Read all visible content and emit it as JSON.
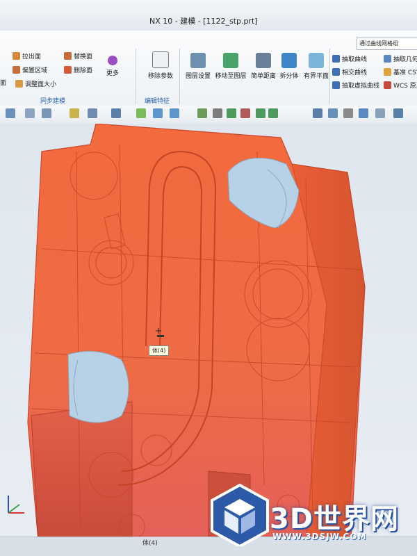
{
  "window": {
    "title": "NX 10 - 建模 - [1122_stp.prt]"
  },
  "search": {
    "value": "通过曲线网格组"
  },
  "ribbon": {
    "sync_group": {
      "label": "同步建模",
      "items": [
        "拉出面",
        "偏置区域",
        "调整面大小",
        "替换面",
        "删除面"
      ],
      "more": "更多",
      "left_cut": "面"
    },
    "edit_group": {
      "label": "编辑特征",
      "items": [
        "移除参数"
      ]
    },
    "tools": {
      "items": [
        "图层设置",
        "移动至图层",
        "简单距离",
        "拆分体",
        "有界平面"
      ]
    },
    "curves": {
      "items": [
        "抽取曲线",
        "相交曲线",
        "抽取虚拟曲线",
        "抽取几何",
        "基准 CSYS",
        "WCS 原点"
      ]
    }
  },
  "viewport": {
    "tooltip": "体(4)"
  },
  "statusbar": {
    "text": "体(4)"
  },
  "watermark": {
    "brand": "3D世界网",
    "url": "WWW.3DSJW.COM"
  },
  "colors": {
    "body": "#ef6a3e",
    "edge": "#c9472a",
    "hole": "#b7d2e6",
    "accent": "#2d5aa8"
  }
}
